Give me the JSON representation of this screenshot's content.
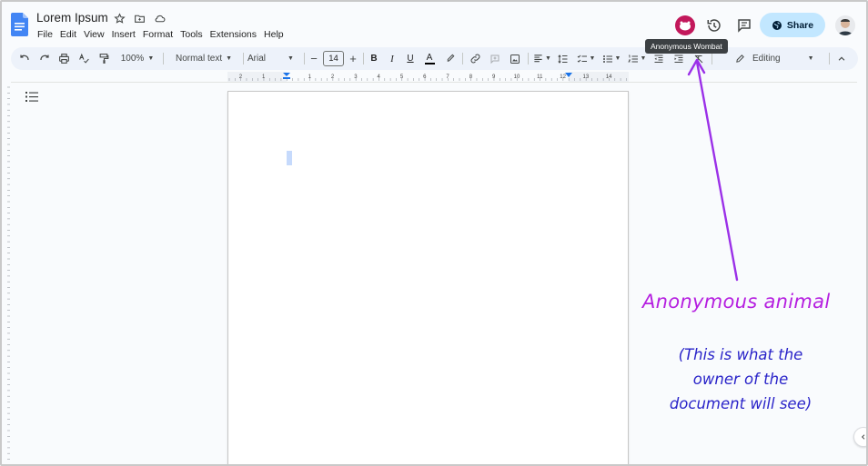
{
  "app": {
    "doc_title": "Lorem Ipsum"
  },
  "menu": [
    "File",
    "Edit",
    "View",
    "Insert",
    "Format",
    "Tools",
    "Extensions",
    "Help"
  ],
  "header": {
    "share_label": "Share",
    "tooltip": "Anonymous Wombat",
    "anon_avatar_color": "#c2185b",
    "share_bg": "#c2e7ff"
  },
  "toolbar": {
    "zoom": "100%",
    "style": "Normal text",
    "font": "Arial",
    "font_size": "14",
    "mode": "Editing"
  },
  "ruler": {
    "numbers": [
      "2",
      "1",
      "1",
      "2",
      "3",
      "4",
      "5",
      "6",
      "7",
      "8",
      "9",
      "10",
      "11",
      "12",
      "13",
      "14",
      "15"
    ]
  },
  "annotation": {
    "title": "Anonymous animal",
    "subtitle_lines": [
      "(This is what the",
      "owner of the",
      "document will see)"
    ],
    "title_color": "#b51fe0",
    "subtitle_color": "#2a24c9",
    "arrow_color": "#9b30e8"
  }
}
